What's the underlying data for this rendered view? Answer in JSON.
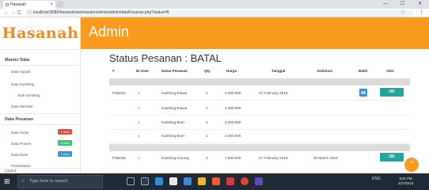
{
  "browser": {
    "tab_title": "Hasanah",
    "tab_close": "×",
    "url": "localhost:8080/hasanahweb/master/admin/admin/dataPesanan.php?status=B",
    "back": "←",
    "forward": "→",
    "reload": "C",
    "info": "ⓘ",
    "star": "☆",
    "menu": "⋮",
    "minimize": "—",
    "maximize": "☐",
    "close": "✕"
  },
  "logo": "Hasanah",
  "header": {
    "title": "Admin"
  },
  "sidebar": {
    "master_title": "Master Data",
    "data_apiyah": "Data Apiyah",
    "data_kambing": "Data Kambing",
    "stok_kambing": "Stok Kambing",
    "data_member": "Data Member",
    "pesanan_title": "Data Pesanan",
    "data_order": "Data Order",
    "data_proses": "Data Proses",
    "data_kirim": "Data Kirim",
    "pembatalan": "Pembatalan",
    "logout": "Logout",
    "badge_order": "1 new",
    "badge_proses": "0 new",
    "badge_kirim": "1 new",
    "badge_order_color": "#e84c3d",
    "badge_proses_color": "#2ecc71",
    "badge_kirim_color": "#3498db"
  },
  "main": {
    "title": "Status Pesanan : BATAL",
    "columns": [
      "#",
      "ID User",
      "Nama Pesanan",
      "Qty",
      "Harga",
      "Tanggal",
      "Estimasi",
      "Bukti",
      "Aksi"
    ],
    "rows": [
      {
        "id": "PSB010",
        "user": "1",
        "nama": "Kambing Etawa",
        "qty": "1",
        "harga": "3.000.000",
        "tanggal": "27 February 2018",
        "estimasi": "",
        "bukti": true,
        "aksi": "OK"
      },
      {
        "id": "",
        "user": "1",
        "nama": "Kambing Etawa",
        "qty": "1",
        "harga": "3.000.000",
        "tanggal": "",
        "estimasi": "",
        "bukti": false,
        "aksi": ""
      },
      {
        "id": "",
        "user": "1",
        "nama": "Kambing Boer",
        "qty": "1",
        "harga": "3.000.000",
        "tanggal": "",
        "estimasi": "",
        "bukti": false,
        "aksi": ""
      },
      {
        "id": "",
        "user": "1",
        "nama": "Kambing Boer",
        "qty": "1",
        "harga": "3.000.000",
        "tanggal": "",
        "estimasi": "",
        "bukti": false,
        "aksi": ""
      },
      {
        "id": "PSB015",
        "user": "1",
        "nama": "Kambing Kacang",
        "qty": "3",
        "harga": "7.500.000",
        "tanggal": "27 February 2018",
        "estimasi": "02 March 2018",
        "bukti": false,
        "aksi": "OK"
      }
    ]
  },
  "fab": "⌃",
  "taskbar": {
    "start": "⊞",
    "search_placeholder": "Type here to search",
    "search_icon": "○",
    "tray": "ENG",
    "time": "9:21 PM",
    "date": "2/27/2018"
  }
}
